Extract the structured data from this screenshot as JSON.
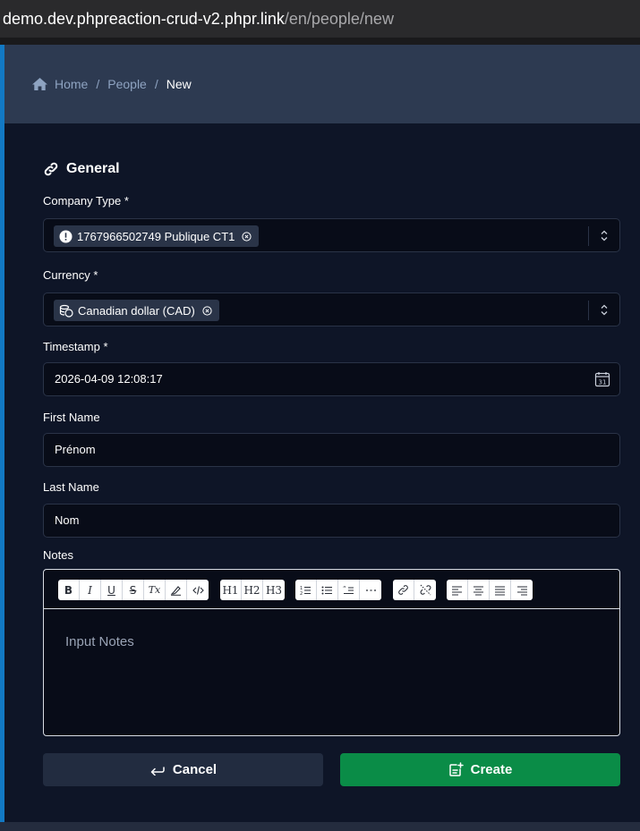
{
  "browser": {
    "url_host": "demo.dev.phpreaction-crud-v2.phpr.link",
    "url_path": "/en/people/new"
  },
  "breadcrumb": {
    "home": "Home",
    "people": "People",
    "current": "New",
    "sep": "/"
  },
  "section": {
    "title": "General"
  },
  "fields": {
    "company_type": {
      "label": "Company Type",
      "required": "*",
      "value": "1767966502749 Publique CT1"
    },
    "currency": {
      "label": "Currency",
      "required": "*",
      "value": "Canadian dollar (CAD)"
    },
    "timestamp": {
      "label": "Timestamp",
      "required": "*",
      "value": "2026-04-09 12:08:17"
    },
    "first_name": {
      "label": "First Name",
      "value": "Prénom"
    },
    "last_name": {
      "label": "Last Name",
      "value": "Nom"
    },
    "notes": {
      "label": "Notes",
      "placeholder": "Input Notes"
    }
  },
  "toolbar": {
    "bold": "B",
    "italic": "I",
    "underline": "U",
    "strike": "S",
    "clear": "Tx",
    "h1": "H1",
    "h2": "H2",
    "h3": "H3"
  },
  "actions": {
    "cancel": "Cancel",
    "create": "Create"
  },
  "colors": {
    "accent": "#1279c4",
    "create": "#0a8c47",
    "header": "#2d3a51"
  }
}
